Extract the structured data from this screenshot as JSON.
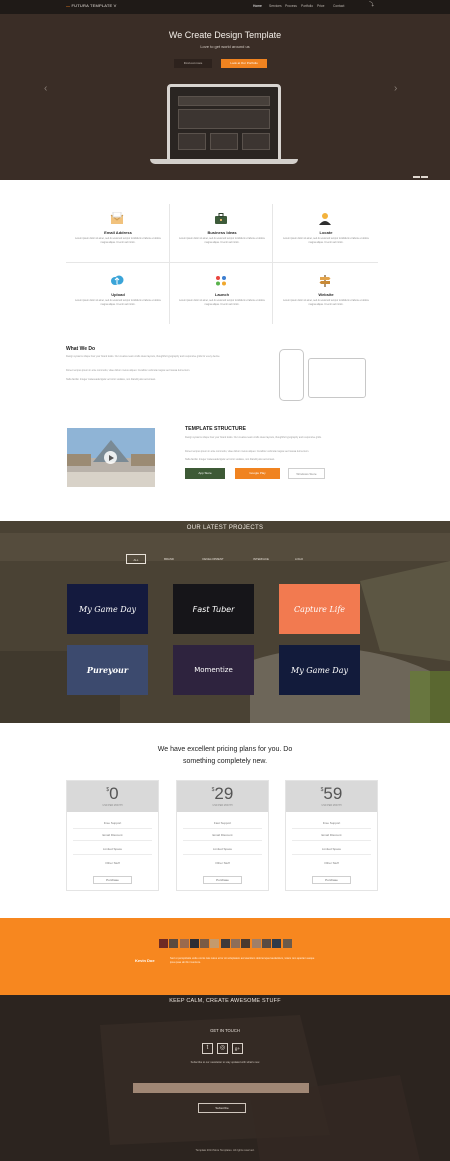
{
  "nav": {
    "logo_prefix": "—",
    "logo": "FUTURA TEMPLATE V",
    "items": [
      {
        "label": "Home",
        "active": true
      },
      {
        "label": "Services",
        "active": false
      },
      {
        "label": "Process",
        "active": false
      },
      {
        "label": "Portfolio",
        "active": false
      },
      {
        "label": "Price",
        "active": false
      },
      {
        "label": "Contact",
        "active": false
      }
    ],
    "share_icon": "share-icon"
  },
  "hero": {
    "title": "We Create Design Template",
    "subtitle": "Love to get world around us",
    "btn_dark": "Find out more",
    "btn_orange": "Look at Our Portfolio",
    "prev_arrow": "‹",
    "next_arrow": "›"
  },
  "features": [
    {
      "title": "Email Address",
      "icon": "envelope-icon",
      "text": "Lorem ipsum dolor sit amet, sed do eiusmod tempor incididunt ut labore et dolore magna aliqua. Ut enim ad minim."
    },
    {
      "title": "Business Ideas",
      "icon": "briefcase-icon",
      "text": "Lorem ipsum dolor sit amet, sed do eiusmod tempor incididunt ut labore et dolore magna aliqua. Ut enim ad minim."
    },
    {
      "title": "Locate",
      "icon": "user-icon",
      "text": "Lorem ipsum dolor sit amet, sed do eiusmod tempor incididunt ut labore et dolore magna aliqua. Ut enim ad minim."
    },
    {
      "title": "Upload",
      "icon": "cloud-upload-icon",
      "text": "Lorem ipsum dolor sit amet, sed do eiusmod tempor incididunt ut labore et dolore magna aliqua. Ut enim ad minim."
    },
    {
      "title": "Launch",
      "icon": "rocket-icon",
      "text": "Lorem ipsum dolor sit amet, sed do eiusmod tempor incididunt ut labore et dolore magna aliqua. Ut enim ad minim."
    },
    {
      "title": "Website",
      "icon": "signpost-icon",
      "text": "Lorem ipsum dolor sit amet, sed do eiusmod tempor incididunt ut labore et dolore magna aliqua. Ut enim ad minim."
    }
  ],
  "what_we_do": {
    "title": "What We Do",
    "paragraphs": [
      "Design systems shape how your brand looks. Our creative team crafts clean layouts, thoughtful typography and responsive grids for every device.",
      "Donec tempus ipsum in ante commodo, vitae dictum metus aliquet. Curabitur vehicula magna sed massa fermentum.",
      "Nulla facilisi. Integer malesuada ligula vel tortor sodales, non blandit justo accumsan."
    ]
  },
  "template_structure": {
    "title": "TEMPLATE STRUCTURE",
    "paragraphs": [
      "Design systems shape how your brand looks. Our creative team crafts clean layouts, thoughtful typography and responsive grids.",
      "Donec tempus ipsum in ante commodo, vitae dictum metus aliquet. Curabitur vehicula magna sed massa fermentum.",
      "Nulla facilisi. Integer malesuada ligula vel tortor sodales, non blandit justo accumsan."
    ],
    "buttons": [
      {
        "label": "App Store",
        "style": "green"
      },
      {
        "label": "Google Play",
        "style": "orange"
      },
      {
        "label": "Windows Store",
        "style": "outline"
      }
    ]
  },
  "projects": {
    "title": "OUR LATEST PROJECTS",
    "filters": [
      {
        "label": "ALL",
        "active": true
      },
      {
        "label": "BRAND",
        "active": false
      },
      {
        "label": "DEVELOPMENT",
        "active": false
      },
      {
        "label": "INTERFACE",
        "active": false
      },
      {
        "label": "LOGO",
        "active": false
      }
    ],
    "tiles": [
      {
        "label": "My Game Day",
        "color": "#141a3e"
      },
      {
        "label": "Fast Tuber",
        "color": "#161519"
      },
      {
        "label": "Capture Life",
        "color": "#f27a50"
      },
      {
        "label": "Pureyour",
        "color": "#3c4a6e"
      },
      {
        "label": "Momentize",
        "color": "#2e233e"
      },
      {
        "label": "My Game Day",
        "color": "#121b3b"
      }
    ]
  },
  "pricing": {
    "heading_line1": "We have excellent pricing plans for you. Do",
    "heading_line2": "something completely new.",
    "plans": [
      {
        "currency": "$",
        "price": "0",
        "period": "USD PER MONTH",
        "features": [
          "Free Support",
          "Email Discount",
          "Limited Space",
          "Other Stuff"
        ],
        "button": "Purchase"
      },
      {
        "currency": "$",
        "price": "29",
        "period": "USD PER MONTH",
        "features": [
          "Fast Support",
          "Email Discount",
          "Limited Space",
          "Other Stuff"
        ],
        "button": "Purchase"
      },
      {
        "currency": "$",
        "price": "59",
        "period": "USD PER MONTH",
        "features": [
          "Free Support",
          "Email Discount",
          "Limited Space",
          "Other Stuff"
        ],
        "button": "Purchase"
      }
    ]
  },
  "testimonial": {
    "name": "Kevin Doe",
    "text": "Sed ut perspiciatis unde omnis iste natus error sit voluptatem accusantium doloremque laudantium, totam rem aperiam eaque ipsa quae ab illo inventore.",
    "avatar_colors": [
      "#6f2a24",
      "#5b4a3f",
      "#9a6a4e",
      "#2e2e34",
      "#7a5b45",
      "#c49a6c",
      "#3e3a3b",
      "#8e6e59",
      "#4b3a2f",
      "#a07f68",
      "#5a4b43",
      "#2f3b4a",
      "#6b5a4a"
    ]
  },
  "footer": {
    "tagline": "KEEP CALM, CREATE AWESOME STUFF",
    "get_in_touch": "GET IN TOUCH",
    "social": [
      {
        "icon": "twitter-icon",
        "glyph": "t"
      },
      {
        "icon": "dribbble-icon",
        "glyph": "◎"
      },
      {
        "icon": "google-plus-icon",
        "glyph": "g+"
      }
    ],
    "subscribe_note": "Subscribe to our newsletter to stay updated with what's new",
    "email_placeholder": "",
    "subscribe_button": "Subscribe",
    "copyright": "Template 2014 More Templates. All rights reserved."
  },
  "colors": {
    "accent": "#f08320",
    "hero_bg": "#3a2d26",
    "footer_bg": "#2c241f"
  }
}
